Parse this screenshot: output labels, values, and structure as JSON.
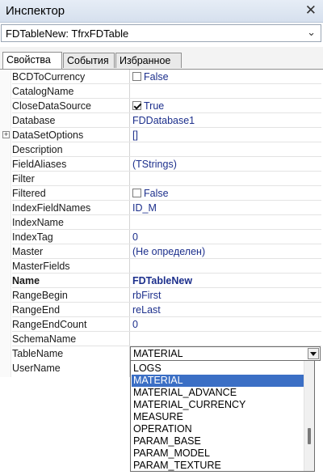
{
  "window": {
    "title": "Инспектор",
    "close_glyph": "✕"
  },
  "object_selector": {
    "value": "FDTableNew: TfrxFDTable"
  },
  "tabs": [
    {
      "label": "Свойства",
      "active": true
    },
    {
      "label": "События",
      "active": false
    },
    {
      "label": "Избранное",
      "active": false
    }
  ],
  "properties": [
    {
      "name": "BCDToCurrency",
      "value": "False",
      "checkbox": false
    },
    {
      "name": "CatalogName",
      "value": ""
    },
    {
      "name": "CloseDataSource",
      "value": "True",
      "checkbox": true
    },
    {
      "name": "Database",
      "value": "FDDatabase1"
    },
    {
      "name": "DataSetOptions",
      "value": "[]",
      "expandable": true
    },
    {
      "name": "Description",
      "value": ""
    },
    {
      "name": "FieldAliases",
      "value": "(TStrings)"
    },
    {
      "name": "Filter",
      "value": ""
    },
    {
      "name": "Filtered",
      "value": "False",
      "checkbox": false
    },
    {
      "name": "IndexFieldNames",
      "value": "ID_M"
    },
    {
      "name": "IndexName",
      "value": ""
    },
    {
      "name": "IndexTag",
      "value": "0"
    },
    {
      "name": "Master",
      "value": "(Не определен)"
    },
    {
      "name": "MasterFields",
      "value": ""
    },
    {
      "name": "Name",
      "value": "FDTableNew",
      "bold": true
    },
    {
      "name": "RangeBegin",
      "value": "rbFirst"
    },
    {
      "name": "RangeEnd",
      "value": "reLast"
    },
    {
      "name": "RangeEndCount",
      "value": "0"
    },
    {
      "name": "SchemaName",
      "value": ""
    },
    {
      "name": "TableName",
      "value": "MATERIAL",
      "editing": true
    },
    {
      "name": "UserName",
      "value": ""
    }
  ],
  "tablename_dropdown": {
    "selected": "MATERIAL",
    "options": [
      "LOGS",
      "MATERIAL",
      "MATERIAL_ADVANCE",
      "MATERIAL_CURRENCY",
      "MEASURE",
      "OPERATION",
      "PARAM_BASE",
      "PARAM_MODEL",
      "PARAM_TEXTURE"
    ]
  },
  "icons": {
    "close": "close-icon",
    "dropdown": "chevron-down-icon",
    "search": "search-icon",
    "expand": "plus-expand-icon"
  },
  "colors": {
    "value_text": "#1c2f8c",
    "selection": "#3b6fc5",
    "title_bg": "#dde6f2"
  }
}
